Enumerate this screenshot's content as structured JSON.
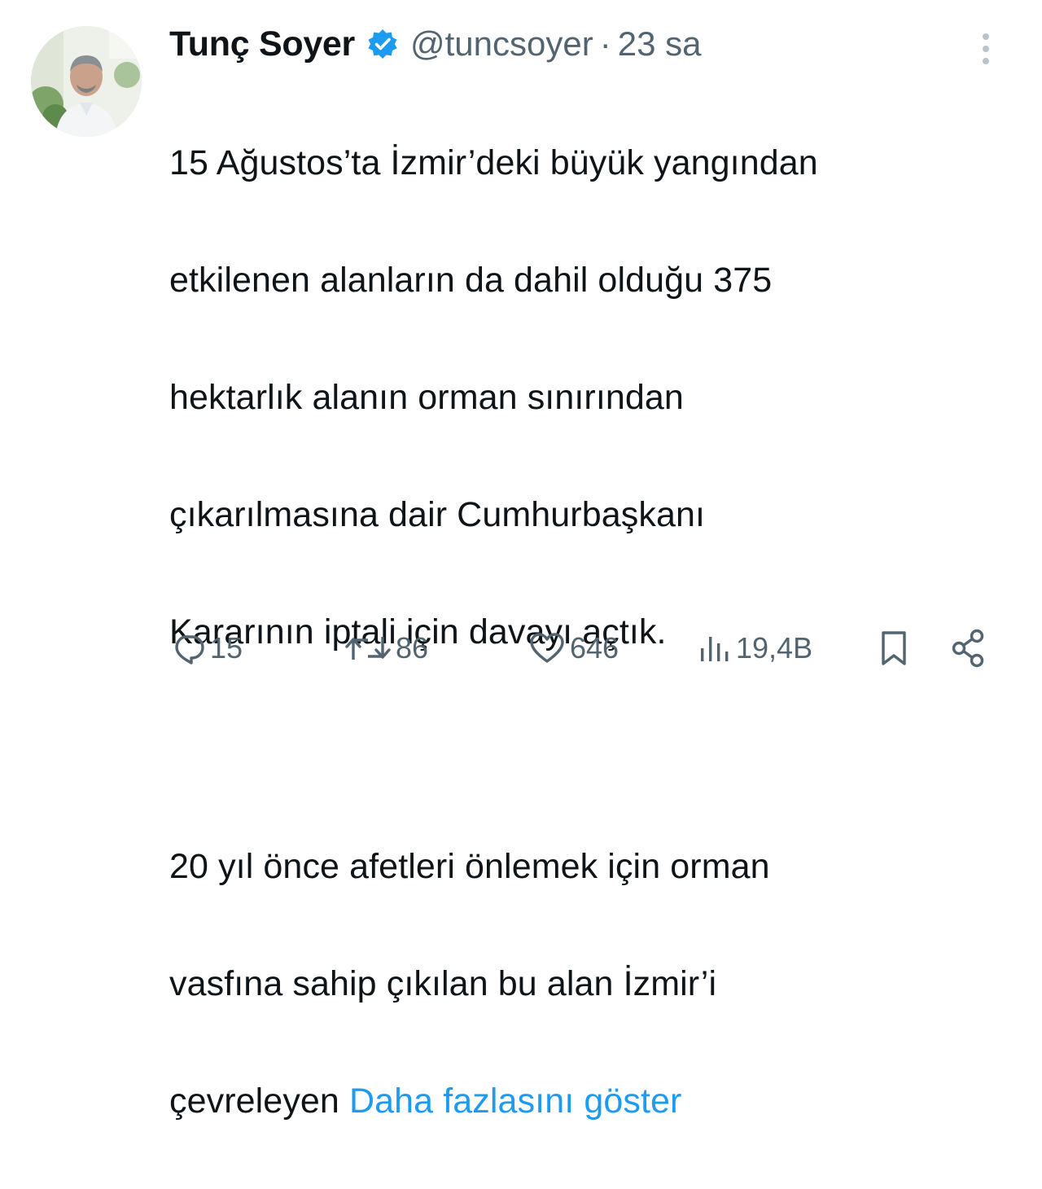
{
  "author": {
    "display_name": "Tunç Soyer",
    "handle": "@tuncsoyer",
    "separator": "·",
    "time": "23 sa",
    "verified": true
  },
  "tweet": {
    "lines": [
      "15 Ağustos’ta İzmir’deki büyük yangından",
      "etkilenen alanların da dahil olduğu 375",
      "hektarlık alanın  orman sınırından",
      "çıkarılmasına dair Cumhurbaşkanı",
      "Kararının iptali için davayı açtık.",
      "20 yıl önce afetleri önlemek için orman",
      "vasfına sahip çıkılan bu alan İzmir’i",
      "çevreleyen "
    ],
    "show_more": "Daha fazlasını göster"
  },
  "actions": {
    "replies": "15",
    "retweets": "86",
    "likes": "646",
    "views": "19,4B"
  },
  "icons": {
    "verified": "verified-badge-icon",
    "more": "more-vertical-icon",
    "reply": "reply-icon",
    "retweet": "retweet-icon",
    "like": "heart-icon",
    "views": "views-chart-icon",
    "bookmark": "bookmark-icon",
    "share": "share-icon"
  },
  "colors": {
    "text": "#0f1419",
    "secondary": "#536471",
    "link": "#1d9bf0",
    "verified": "#1d9bf0"
  }
}
